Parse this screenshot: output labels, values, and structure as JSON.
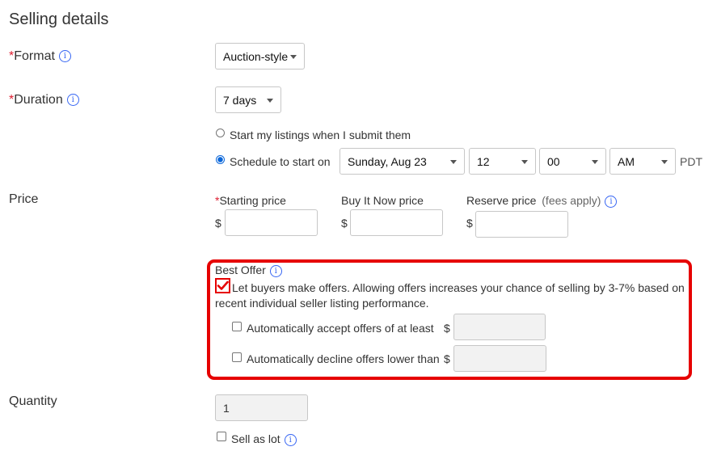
{
  "section_title": "Selling details",
  "format": {
    "label": "Format",
    "value": "Auction-style"
  },
  "duration": {
    "label": "Duration",
    "value": "7 days",
    "start_now_label": "Start my listings when I submit them",
    "schedule_label": "Schedule to start on",
    "date_value": "Sunday, Aug 23",
    "hour_value": "12",
    "minute_value": "00",
    "ampm_value": "AM",
    "timezone": "PDT"
  },
  "price": {
    "label": "Price",
    "starting_label": "Starting price",
    "buy_now_label": "Buy It Now price",
    "reserve_label": "Reserve price",
    "reserve_note": "(fees apply)",
    "currency": "$"
  },
  "best_offer": {
    "label": "Best Offer",
    "allow_text": "Let buyers make offers. Allowing offers increases your chance of selling by 3-7% based on",
    "allow_text_line2": "recent individual seller listing performance.",
    "auto_accept_label": "Automatically accept offers of at least",
    "auto_decline_label": "Automatically decline offers lower than",
    "currency": "$"
  },
  "quantity": {
    "label": "Quantity",
    "value": "1",
    "lot_label": "Sell as lot"
  },
  "required_mark": "*",
  "info_glyph": "i",
  "colors": {
    "required": "#dd1e31",
    "info": "#3665f3",
    "highlight": "#e60000",
    "radio_on": "#0a66d9"
  }
}
